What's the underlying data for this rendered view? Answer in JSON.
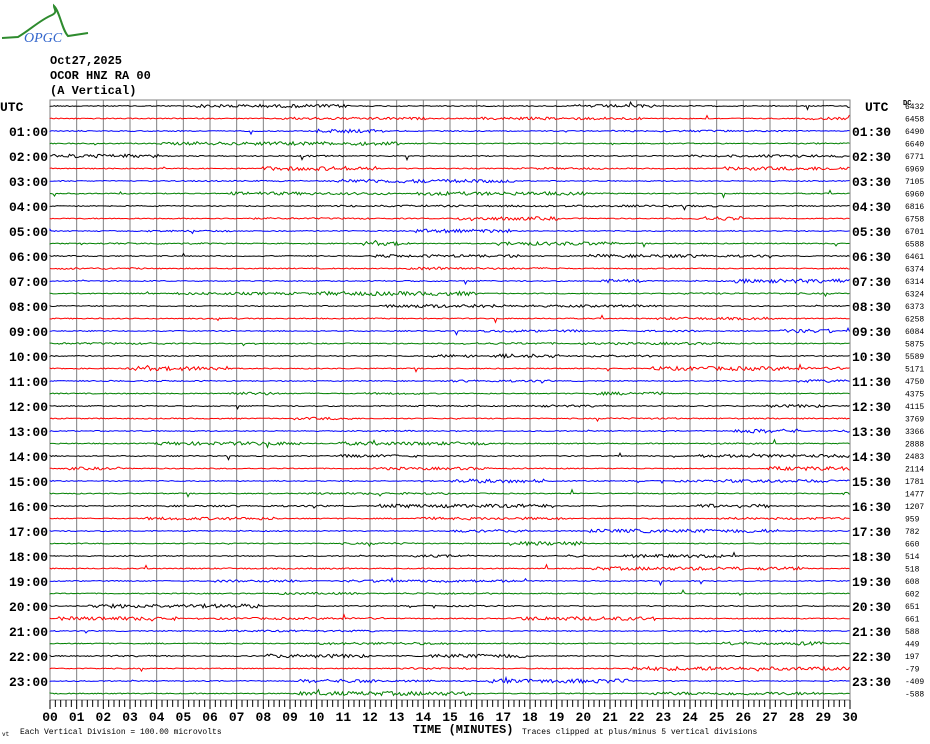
{
  "header": {
    "logo_text": "OPGC",
    "date": "Oct27,2025",
    "station": "OCOR HNZ RA 00",
    "component": "(A Vertical)"
  },
  "colors": {
    "trace_cycle": [
      "#000000",
      "#ff0000",
      "#0000ff",
      "#008000"
    ],
    "grid": "#808080",
    "logo_green": "#2e8b2e",
    "logo_blue": "#3366cc"
  },
  "chart_data": {
    "type": "line",
    "title": "OCOR HNZ RA 00 (A Vertical) Oct27,2025",
    "xlabel": "TIME (MINUTES)",
    "xlim": [
      0,
      30
    ],
    "x_ticks": [
      "00",
      "01",
      "02",
      "03",
      "04",
      "05",
      "06",
      "07",
      "08",
      "09",
      "10",
      "11",
      "12",
      "13",
      "14",
      "15",
      "16",
      "17",
      "18",
      "19",
      "20",
      "21",
      "22",
      "23",
      "24",
      "25",
      "26",
      "27",
      "28",
      "29",
      "30"
    ],
    "left_label_header": "UTC",
    "right_label_header": "UTC",
    "dc_header": "DC",
    "left_labels": [
      "UTC",
      "01:00",
      "02:00",
      "03:00",
      "04:00",
      "05:00",
      "06:00",
      "07:00",
      "08:00",
      "09:00",
      "10:00",
      "11:00",
      "12:00",
      "13:00",
      "14:00",
      "15:00",
      "16:00",
      "17:00",
      "18:00",
      "19:00",
      "20:00",
      "21:00",
      "22:00",
      "23:00"
    ],
    "right_labels": [
      "UTC",
      "01:30",
      "02:30",
      "03:30",
      "04:30",
      "05:30",
      "06:30",
      "07:30",
      "08:30",
      "09:30",
      "10:30",
      "11:30",
      "12:30",
      "13:30",
      "14:30",
      "15:30",
      "16:30",
      "17:30",
      "18:30",
      "19:30",
      "20:30",
      "21:30",
      "22:30",
      "23:30"
    ],
    "dc_offsets": [
      6432,
      6458,
      6490,
      6640,
      6771,
      6969,
      7105,
      6960,
      6816,
      6758,
      6701,
      6588,
      6461,
      6374,
      6314,
      6324,
      6373,
      6258,
      6084,
      5875,
      5589,
      5171,
      4750,
      4375,
      4115,
      3769,
      3366,
      2888,
      2483,
      2114,
      1781,
      1477,
      1207,
      959,
      782,
      660,
      514,
      518,
      608,
      602,
      651,
      661,
      588,
      449,
      197,
      -79,
      -409,
      -588
    ],
    "traces_per_hour": 2,
    "minutes_per_trace": 30,
    "footer_scale": "Each Vertical Division =  100.00 microvolts",
    "footer_clip": "Traces clipped at plus/minus 5 vertical divisions",
    "footer_mark": "vt"
  }
}
